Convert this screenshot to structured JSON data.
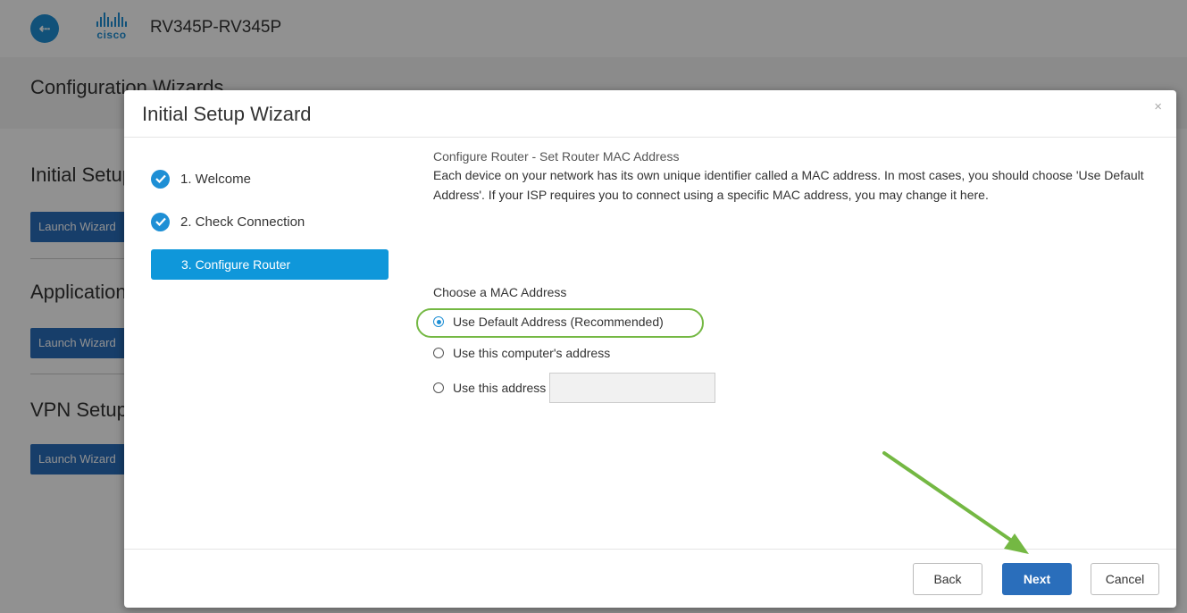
{
  "topbar": {
    "device_name": "RV345P-RV345P",
    "logo_text": "cisco"
  },
  "page": {
    "title": "Configuration Wizards"
  },
  "background_sections": [
    {
      "title": "Initial Setup",
      "button": "Launch Wizard"
    },
    {
      "title": "Application",
      "button": "Launch Wizard"
    },
    {
      "title": "VPN Setup",
      "button": "Launch Wizard"
    }
  ],
  "modal": {
    "title": "Initial Setup Wizard",
    "close": "×",
    "steps": [
      {
        "label": "1. Welcome",
        "state": "complete"
      },
      {
        "label": "2. Check Connection",
        "state": "complete"
      },
      {
        "label": "3. Configure Router",
        "state": "active"
      }
    ],
    "content": {
      "subtitle": "Configure Router - Set Router MAC Address",
      "description": "Each device on your network has its own unique identifier called a MAC address. In most cases, you should choose 'Use Default Address'. If your ISP requires you to connect using a specific MAC address, you may change it here.",
      "mac_label": "Choose a MAC Address",
      "options": [
        {
          "label": "Use Default Address (Recommended)",
          "checked": true
        },
        {
          "label": "Use this computer's address",
          "checked": false
        },
        {
          "label": "Use this address",
          "checked": false
        }
      ],
      "address_value": ""
    },
    "footer": {
      "back": "Back",
      "next": "Next",
      "cancel": "Cancel"
    }
  },
  "colors": {
    "accent": "#1e8fd5",
    "primary_button": "#2a6ebb",
    "highlight": "#74b843"
  }
}
